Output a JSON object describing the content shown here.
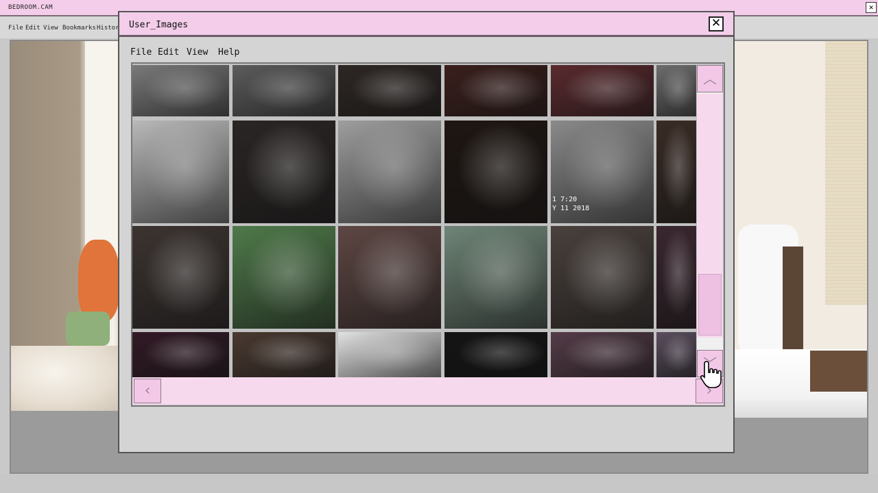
{
  "background_window": {
    "title": "BEDROOM.CAM",
    "close_glyph": "✕",
    "menu": [
      "File",
      "Edit",
      "View",
      "Bookmarks",
      "Histor"
    ]
  },
  "dialog": {
    "title": "User_Images",
    "close_glyph": "✕",
    "menu": [
      "File",
      "Edit",
      "View",
      "Help"
    ]
  },
  "scrollbars": {
    "up_glyph": "︿",
    "down_glyph": "﹀",
    "left_glyph": "‹",
    "right_glyph": "›"
  },
  "thumbnails": {
    "rows": 4,
    "cols": 6,
    "overlay_text": [
      "1 7:20",
      "Y 11 2018"
    ],
    "colors": [
      [
        "#7a7a7a",
        "#5c5c5c",
        "#2e2724",
        "#3a1f1c",
        "#5a2a2e",
        "#6e6e6e"
      ],
      [
        "#b9b9b9",
        "#2b2625",
        "#9e9e9e",
        "#1e1612",
        "#8a8a8a",
        "#3a2c26"
      ],
      [
        "#3c3431",
        "#4f7a4a",
        "#5e4744",
        "#6f8577",
        "#4a413d",
        "#3b2730"
      ],
      [
        "#321a26",
        "#4a3a31",
        "#e2e2e2",
        "#141414",
        "#553c48",
        "#5b4e5e"
      ]
    ]
  }
}
